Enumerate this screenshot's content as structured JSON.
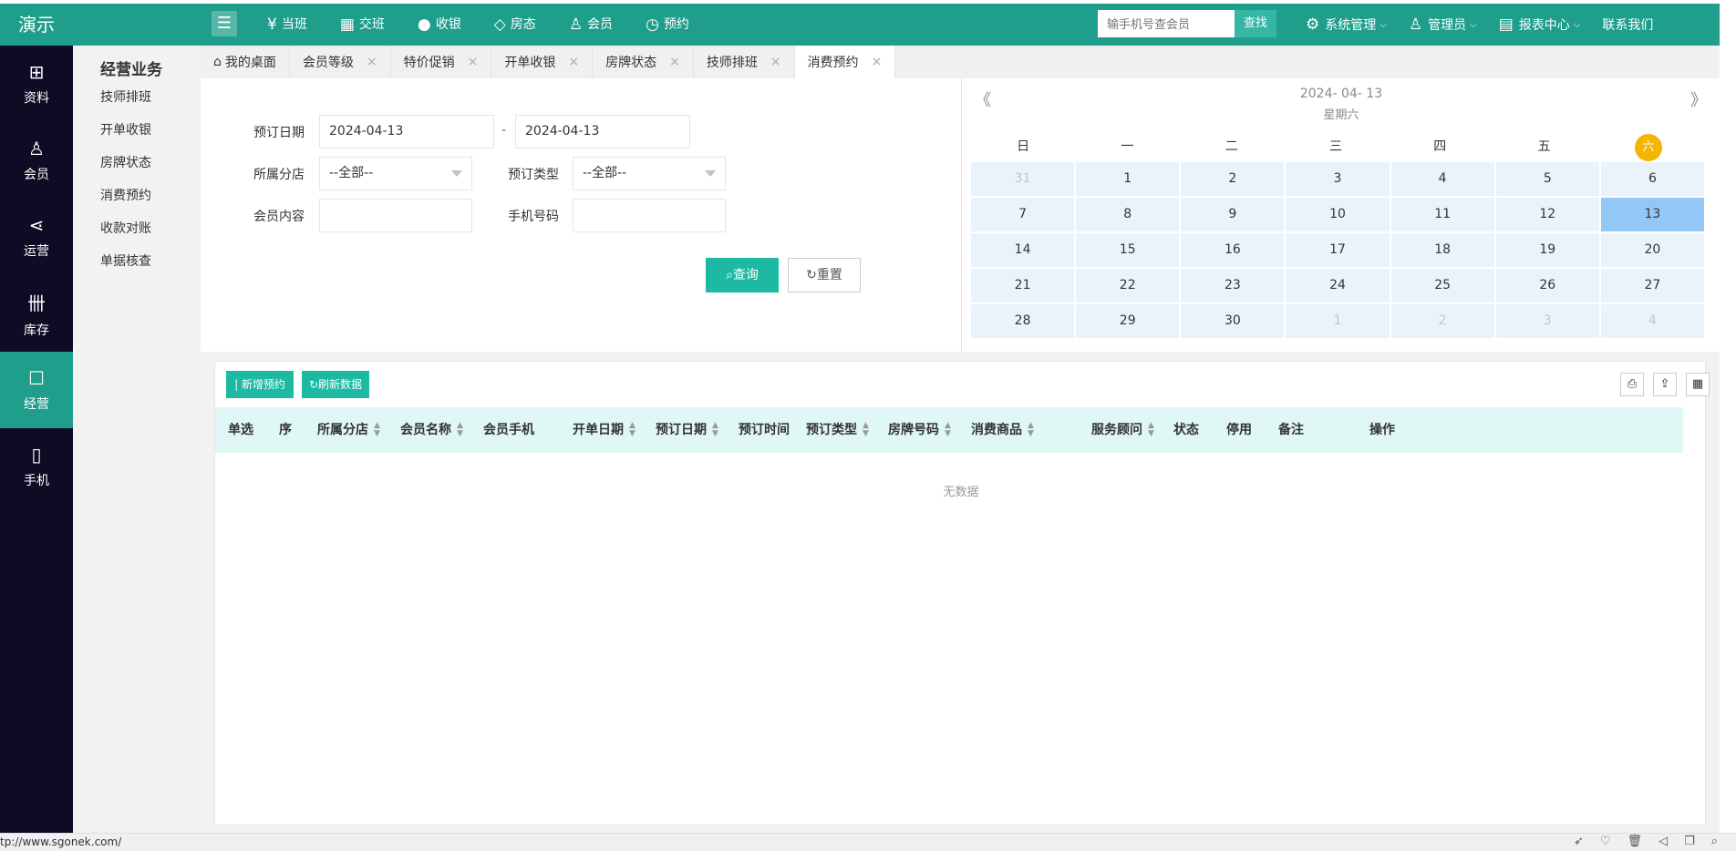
{
  "app": {
    "logo": "演示"
  },
  "topnav": [
    {
      "icon": "¥",
      "label": "当班"
    },
    {
      "icon": "▦",
      "label": "交班"
    },
    {
      "icon": "●",
      "label": "收银"
    },
    {
      "icon": "◇",
      "label": "房态"
    },
    {
      "icon": "♙",
      "label": "会员"
    },
    {
      "icon": "◷",
      "label": "预约"
    }
  ],
  "search": {
    "placeholder": "输手机号查会员",
    "button": "查找"
  },
  "topright": [
    {
      "icon": "⚙",
      "label": "系统管理",
      "caret": true
    },
    {
      "icon": "♙",
      "label": "管理员",
      "caret": true
    },
    {
      "icon": "▤",
      "label": "报表中心",
      "caret": true
    },
    {
      "icon": "",
      "label": "联系我们",
      "caret": false
    }
  ],
  "rail": [
    {
      "icon": "⊞",
      "label": "资料"
    },
    {
      "icon": "♙",
      "label": "会员"
    },
    {
      "icon": "⋖",
      "label": "运营"
    },
    {
      "icon": "卌",
      "label": "库存"
    },
    {
      "icon": "☐",
      "label": "经营",
      "active": true
    },
    {
      "icon": "▯",
      "label": "手机"
    }
  ],
  "subnav": {
    "title": "经营业务",
    "items": [
      "技师排班",
      "开单收银",
      "房牌状态",
      "消费预约",
      "收款对账",
      "单据核查"
    ]
  },
  "tabs": [
    {
      "label": "我的桌面",
      "closable": false,
      "home": true
    },
    {
      "label": "会员等级",
      "closable": true
    },
    {
      "label": "特价促销",
      "closable": true
    },
    {
      "label": "开单收银",
      "closable": true
    },
    {
      "label": "房牌状态",
      "closable": true
    },
    {
      "label": "技师排班",
      "closable": true
    },
    {
      "label": "消费预约",
      "closable": true,
      "active": true
    }
  ],
  "filter": {
    "date_label": "预订日期",
    "date_from": "2024-04-13",
    "date_sep": "-",
    "date_to": "2024-04-13",
    "branch_label": "所属分店",
    "branch_value": "--全部--",
    "type_label": "预订类型",
    "type_value": "--全部--",
    "member_label": "会员内容",
    "member_value": "",
    "phone_label": "手机号码",
    "phone_value": "",
    "query_button": "查询",
    "reset_button": "重置"
  },
  "calendar": {
    "prev": "《",
    "next": "》",
    "date": "2024- 04- 13",
    "weekday": "星期六",
    "week_headers": [
      "日",
      "一",
      "二",
      "三",
      "四",
      "五",
      "六"
    ],
    "days": [
      {
        "d": "31",
        "dim": true
      },
      {
        "d": "1"
      },
      {
        "d": "2"
      },
      {
        "d": "3"
      },
      {
        "d": "4"
      },
      {
        "d": "5"
      },
      {
        "d": "6"
      },
      {
        "d": "7"
      },
      {
        "d": "8"
      },
      {
        "d": "9"
      },
      {
        "d": "10"
      },
      {
        "d": "11"
      },
      {
        "d": "12"
      },
      {
        "d": "13",
        "selected": true
      },
      {
        "d": "14"
      },
      {
        "d": "15"
      },
      {
        "d": "16"
      },
      {
        "d": "17"
      },
      {
        "d": "18"
      },
      {
        "d": "19"
      },
      {
        "d": "20"
      },
      {
        "d": "21"
      },
      {
        "d": "22"
      },
      {
        "d": "23"
      },
      {
        "d": "24"
      },
      {
        "d": "25"
      },
      {
        "d": "26"
      },
      {
        "d": "27"
      },
      {
        "d": "28"
      },
      {
        "d": "29"
      },
      {
        "d": "30"
      },
      {
        "d": "1",
        "dim": true
      },
      {
        "d": "2",
        "dim": true
      },
      {
        "d": "3",
        "dim": true
      },
      {
        "d": "4",
        "dim": true
      }
    ]
  },
  "toolbar": {
    "add_button": "新增预约",
    "refresh_button": "刷新数据"
  },
  "table": {
    "columns": [
      {
        "label": "单选",
        "sortable": false
      },
      {
        "label": "序",
        "sortable": false
      },
      {
        "label": "所属分店",
        "sortable": true
      },
      {
        "label": "会员名称",
        "sortable": true
      },
      {
        "label": "会员手机",
        "sortable": false
      },
      {
        "label": "开单日期",
        "sortable": true
      },
      {
        "label": "预订日期",
        "sortable": true
      },
      {
        "label": "预订时间",
        "sortable": false
      },
      {
        "label": "预订类型",
        "sortable": true
      },
      {
        "label": "房牌号码",
        "sortable": true
      },
      {
        "label": "消费商品",
        "sortable": true
      },
      {
        "label": "服务顾问",
        "sortable": true
      },
      {
        "label": "状态",
        "sortable": false
      },
      {
        "label": "停用",
        "sortable": false
      },
      {
        "label": "备注",
        "sortable": false
      },
      {
        "label": "操作",
        "sortable": false
      }
    ],
    "empty_text": "无数据"
  },
  "statusbar": {
    "url": "tp://www.sgonek.com/"
  },
  "colors": {
    "primary": "#1e9e8b",
    "accent": "#1eb9a3",
    "rail": "#0e0b24",
    "today": "#f5b400",
    "selected_day": "#93c8f6"
  }
}
